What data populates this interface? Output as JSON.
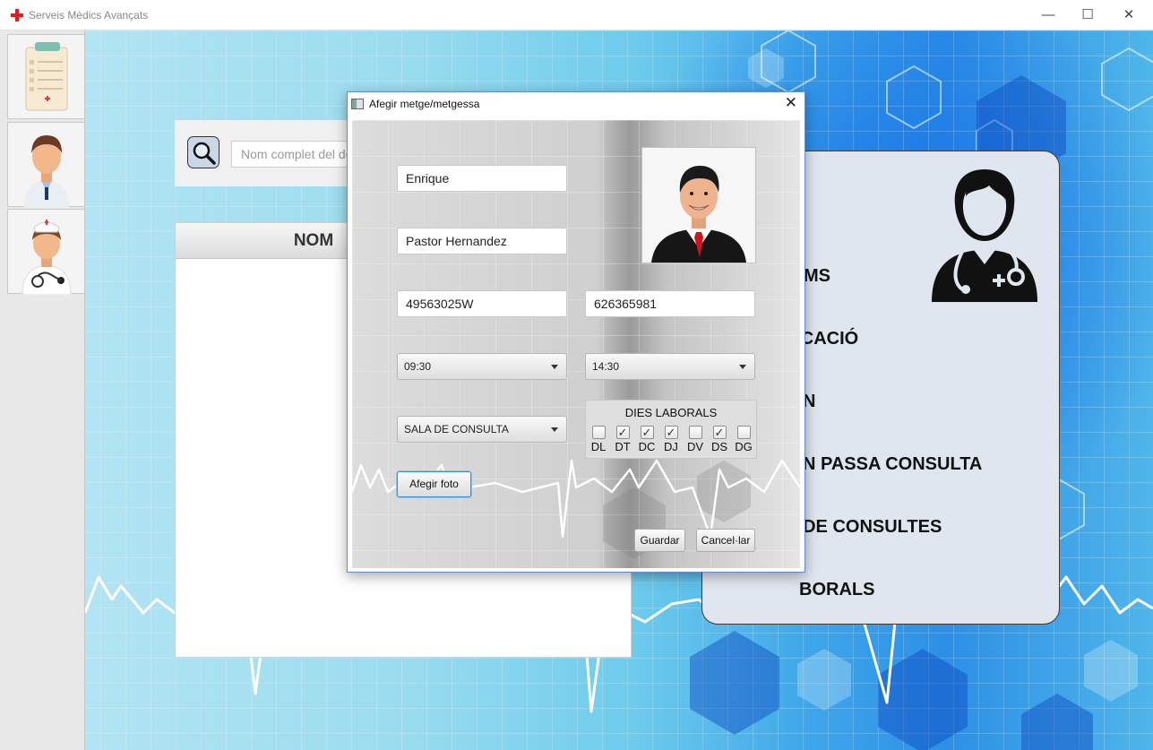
{
  "window": {
    "title": "Serveis Mèdics Avançats",
    "minimize": "—",
    "maximize": "☐",
    "close": "✕"
  },
  "sidebar": {
    "items": [
      {
        "name": "clipboard-icon"
      },
      {
        "name": "doctor-icon"
      },
      {
        "name": "nurse-icon"
      }
    ]
  },
  "search": {
    "placeholder": "Nom complet del doctor",
    "value": ""
  },
  "table": {
    "columns": [
      "NOM"
    ]
  },
  "info_card": {
    "items": [
      "NOMS",
      "IDENTIFICACIÓ",
      "HORARI D'ATENCIÓ",
      "SALA ON PASSA CONSULTA",
      "SALA DE CONSULTES",
      "DIES LABORALS"
    ],
    "visible": [
      "MS",
      "FICACIÓ",
      "N",
      "N PASSA CONSULTA",
      "I DE CONSULTES",
      "BORALS"
    ]
  },
  "dialog": {
    "title": "Afegir metge/metgessa",
    "close": "✕",
    "nom": "Enrique",
    "cognoms": "Pastor Hernandez",
    "dni": "49563025W",
    "telefon": "626365981",
    "hora_inici": "09:30",
    "hora_fi": "14:30",
    "sala": "SALA DE CONSULTA",
    "dies_title": "DIES LABORALS",
    "days": [
      {
        "label": "DL",
        "checked": false
      },
      {
        "label": "DT",
        "checked": true
      },
      {
        "label": "DC",
        "checked": true
      },
      {
        "label": "DJ",
        "checked": true
      },
      {
        "label": "DV",
        "checked": false
      },
      {
        "label": "DS",
        "checked": true
      },
      {
        "label": "DG",
        "checked": false
      }
    ],
    "afegir_foto": "Afegir foto",
    "guardar": "Guardar",
    "cancel": "Cancel·lar"
  }
}
